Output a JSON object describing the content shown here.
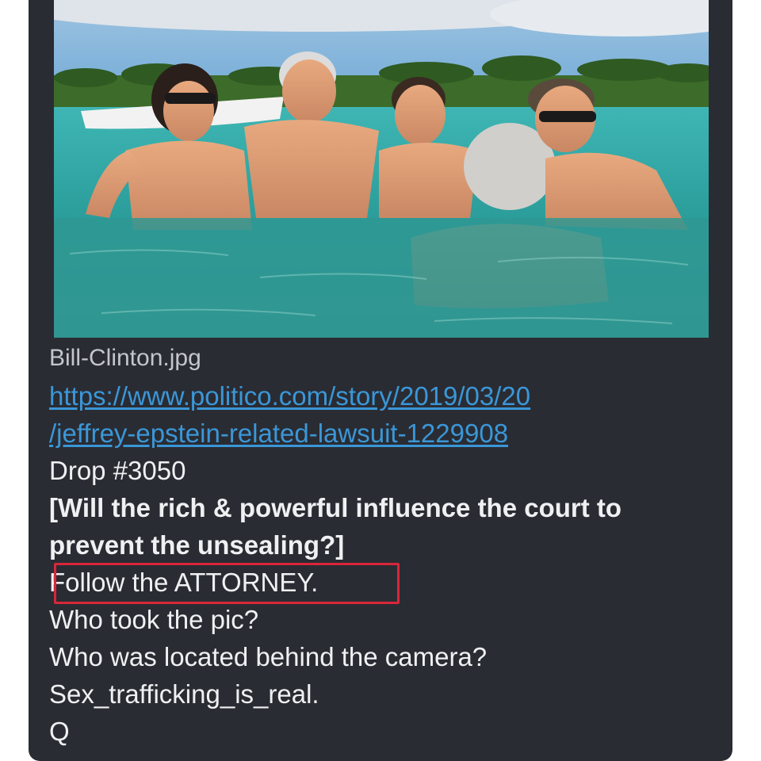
{
  "post": {
    "image_caption": "Bill-Clinton.jpg",
    "link_line1": "https://www.politico.com/story/2019/03/20",
    "link_line2": "/jeffrey-epstein-related-lawsuit-1229908",
    "drop": "Drop #3050",
    "question_bold": "[Will the rich & powerful influence the court to prevent the unsealing?]",
    "highlighted": "Follow the ATTORNEY.",
    "line_pic": "Who took the pic?",
    "line_camera": "Who was located behind the camera?",
    "line_sex": "Sex_trafficking_is_real.",
    "signature": "Q"
  },
  "colors": {
    "card_bg": "#2a2c33",
    "link": "#3a97d8",
    "highlight_box": "#d9263a"
  }
}
